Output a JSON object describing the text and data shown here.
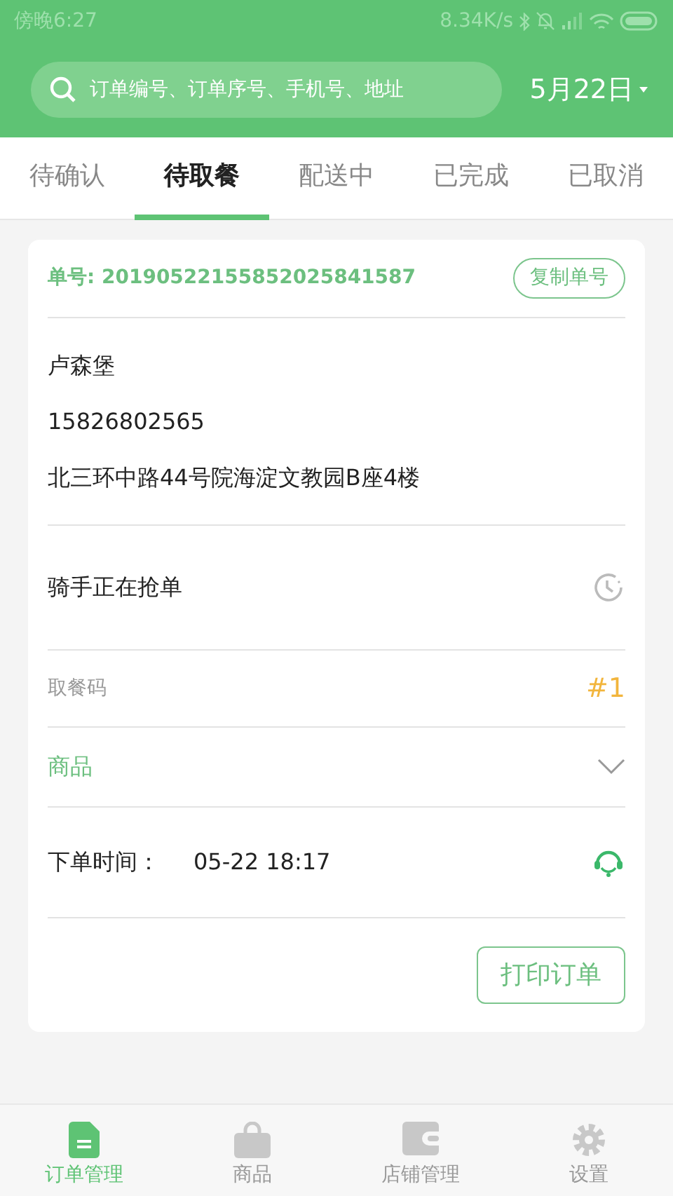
{
  "status_bar": {
    "time": "傍晚6:27",
    "speed": "8.34K/s"
  },
  "header": {
    "search": {
      "placeholder": "订单编号、订单序号、手机号、地址"
    },
    "date": "5月22日"
  },
  "tabs": [
    {
      "label": "待确认",
      "selected": false
    },
    {
      "label": "待取餐",
      "selected": true
    },
    {
      "label": "配送中",
      "selected": false
    },
    {
      "label": "已完成",
      "selected": false
    },
    {
      "label": "已取消",
      "selected": false
    }
  ],
  "order": {
    "number": "单号: 20190522155852025841587",
    "copy_button": "复制单号",
    "customer": {
      "name": "卢森堡",
      "phone": "15826802565",
      "address": "北三环中路44号院海淀文教园B座4楼"
    },
    "rider_status": "骑手正在抢单",
    "pickup_code": {
      "label": "取餐码",
      "value": "#1"
    },
    "goods": {
      "label": "商品",
      "expanded": false
    },
    "order_time": {
      "label": "下单时间：",
      "value": "05-22 18:17"
    },
    "print_button": "打印订单"
  },
  "bottom_nav": [
    {
      "label": "订单管理",
      "kind": "orders",
      "selected": true
    },
    {
      "label": "商品",
      "kind": "goods",
      "selected": false
    },
    {
      "label": "店铺管理",
      "kind": "shop",
      "selected": false
    },
    {
      "label": "设置",
      "kind": "settings",
      "selected": false
    }
  ]
}
